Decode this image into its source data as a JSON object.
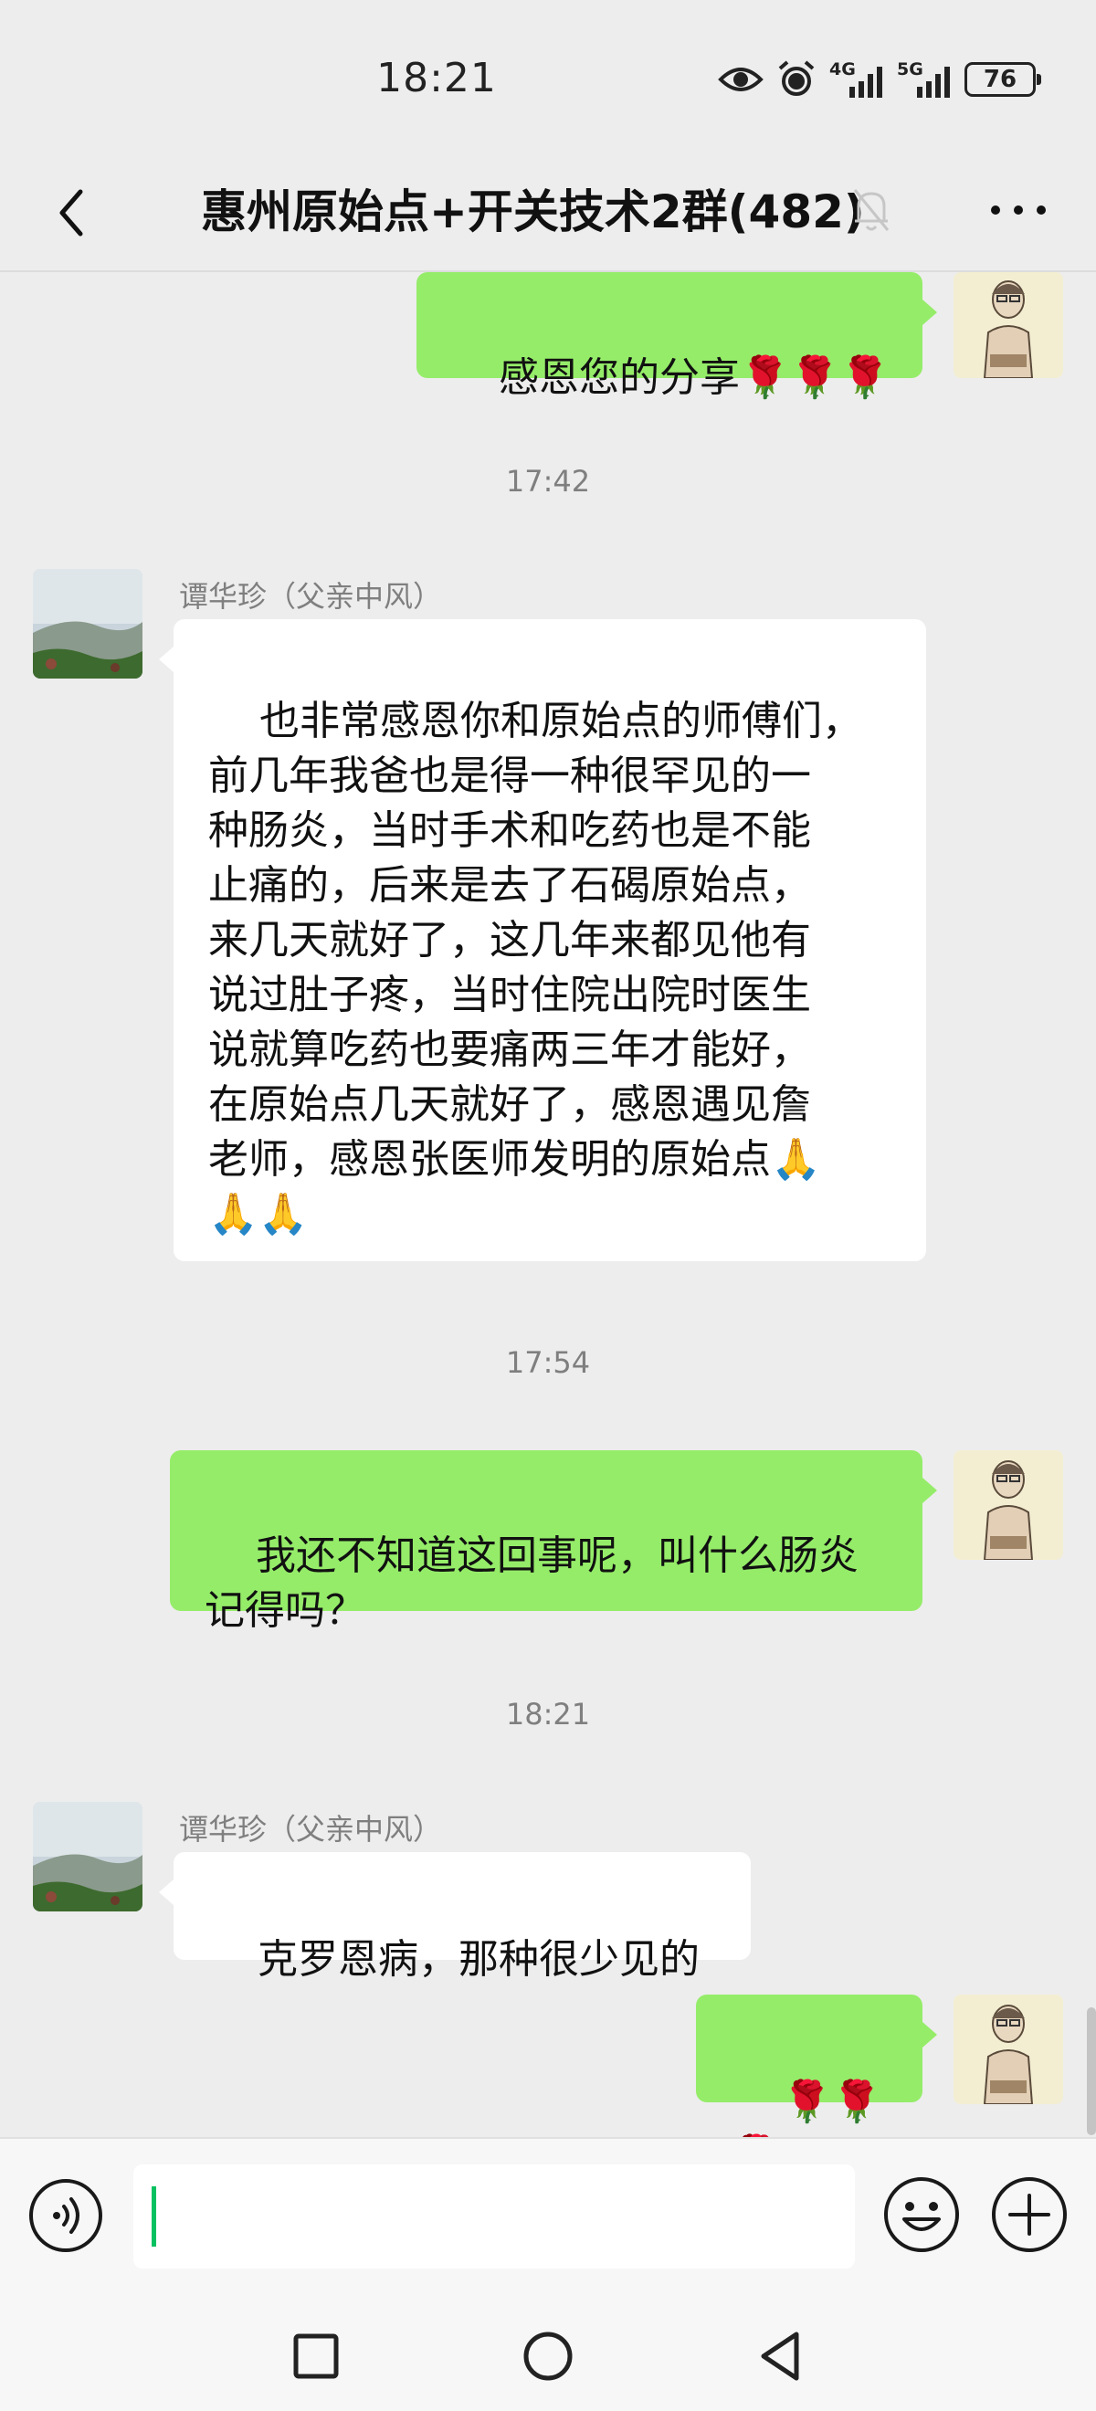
{
  "status_bar": {
    "time": "18:21",
    "icons": [
      "eye-icon",
      "alarm-icon",
      "signal-4g-icon",
      "signal-5g-icon",
      "battery-icon"
    ],
    "net1": "4G",
    "net2": "5G",
    "battery": "76"
  },
  "header": {
    "title": "惠州原始点+开关技术2群(482)",
    "icons": [
      "back-icon",
      "mute-bell-icon",
      "more-icon"
    ]
  },
  "messages": {
    "m1": {
      "text": "感恩您的分享🌹🌹🌹"
    },
    "t1": "17:42",
    "m2": {
      "sender": "谭华珍（父亲中风）",
      "text": "也非常感恩你和原始点的师傅们，\n前几年我爸也是得一种很罕见的一\n种肠炎，当时手术和吃药也是不能\n止痛的，后来是去了石碣原始点，\n来几天就好了，这几年来都见他有\n说过肚子疼，当时住院出院时医生\n说就算吃药也要痛两三年才能好，\n在原始点几天就好了，感恩遇见詹\n老师，感恩张医师发明的原始点🙏\n🙏🙏"
    },
    "t2": "17:54",
    "m3": {
      "text": "我还不知道这回事呢，叫什么肠炎\n记得吗？"
    },
    "t3": "18:21",
    "m4": {
      "sender": "谭华珍（父亲中风）",
      "text": "克罗恩病，那种很少见的"
    },
    "m5": {
      "text": "🌹🌹🌹"
    }
  },
  "input_bar": {
    "value": "",
    "icons": [
      "voice-icon",
      "emoji-icon",
      "plus-icon"
    ]
  },
  "nav_bar": {
    "icons": [
      "recents-icon",
      "home-icon",
      "back-triangle-icon"
    ]
  },
  "colors": {
    "background": "#ededed",
    "bubble_out": "#95ec69",
    "bubble_in": "#ffffff",
    "caret": "#07c160",
    "meta_text": "#7f7f7f"
  }
}
